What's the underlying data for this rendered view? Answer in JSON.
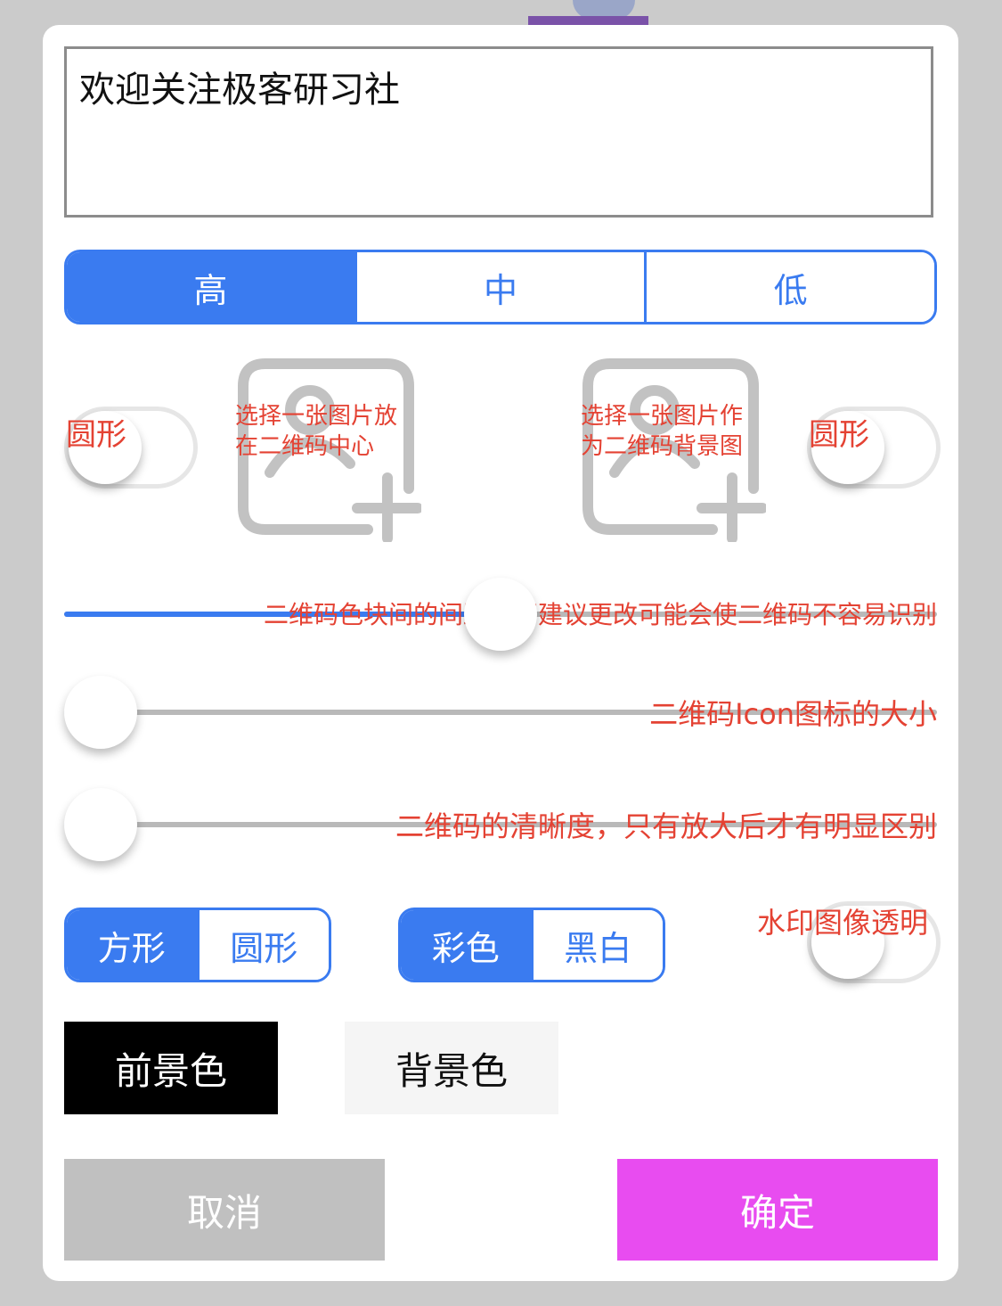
{
  "text_input": {
    "value": "欢迎关注极客研习社"
  },
  "quality": {
    "options": [
      "高",
      "中",
      "低"
    ],
    "selected": "高"
  },
  "logo_toggle": {
    "label": "圆形",
    "on": false
  },
  "background_toggle": {
    "label": "圆形",
    "on": false
  },
  "center_image": {
    "hint": "选择一张图片放在二维码中心",
    "icon": "add-image-icon"
  },
  "background_image": {
    "hint": "选择一张图片作为二维码背景图",
    "icon": "add-image-icon"
  },
  "sliders": {
    "margin": {
      "caption": "二维码色块间的间距，不建议更改可能会使二维码不容易识别",
      "value": 0.5
    },
    "icon_size": {
      "caption": "二维码Icon图标的大小",
      "value": 0.0
    },
    "clarity": {
      "caption": "二维码的清晰度，只有放大后才有明显区别",
      "value": 0.0
    }
  },
  "shape": {
    "options": [
      "方形",
      "圆形"
    ],
    "selected": "方形"
  },
  "color_mode": {
    "options": [
      "彩色",
      "黑白"
    ],
    "selected": "彩色"
  },
  "watermark": {
    "label": "水印图像透明",
    "on": false
  },
  "foreground_button": {
    "label": "前景色"
  },
  "background_button": {
    "label": "背景色"
  },
  "cancel_button": {
    "label": "取消"
  },
  "confirm_button": {
    "label": "确定"
  },
  "colors": {
    "accent": "#3a7bf0",
    "hint_red": "#e44233",
    "confirm": "#e84cf0",
    "cancel": "#c0c0c0"
  }
}
